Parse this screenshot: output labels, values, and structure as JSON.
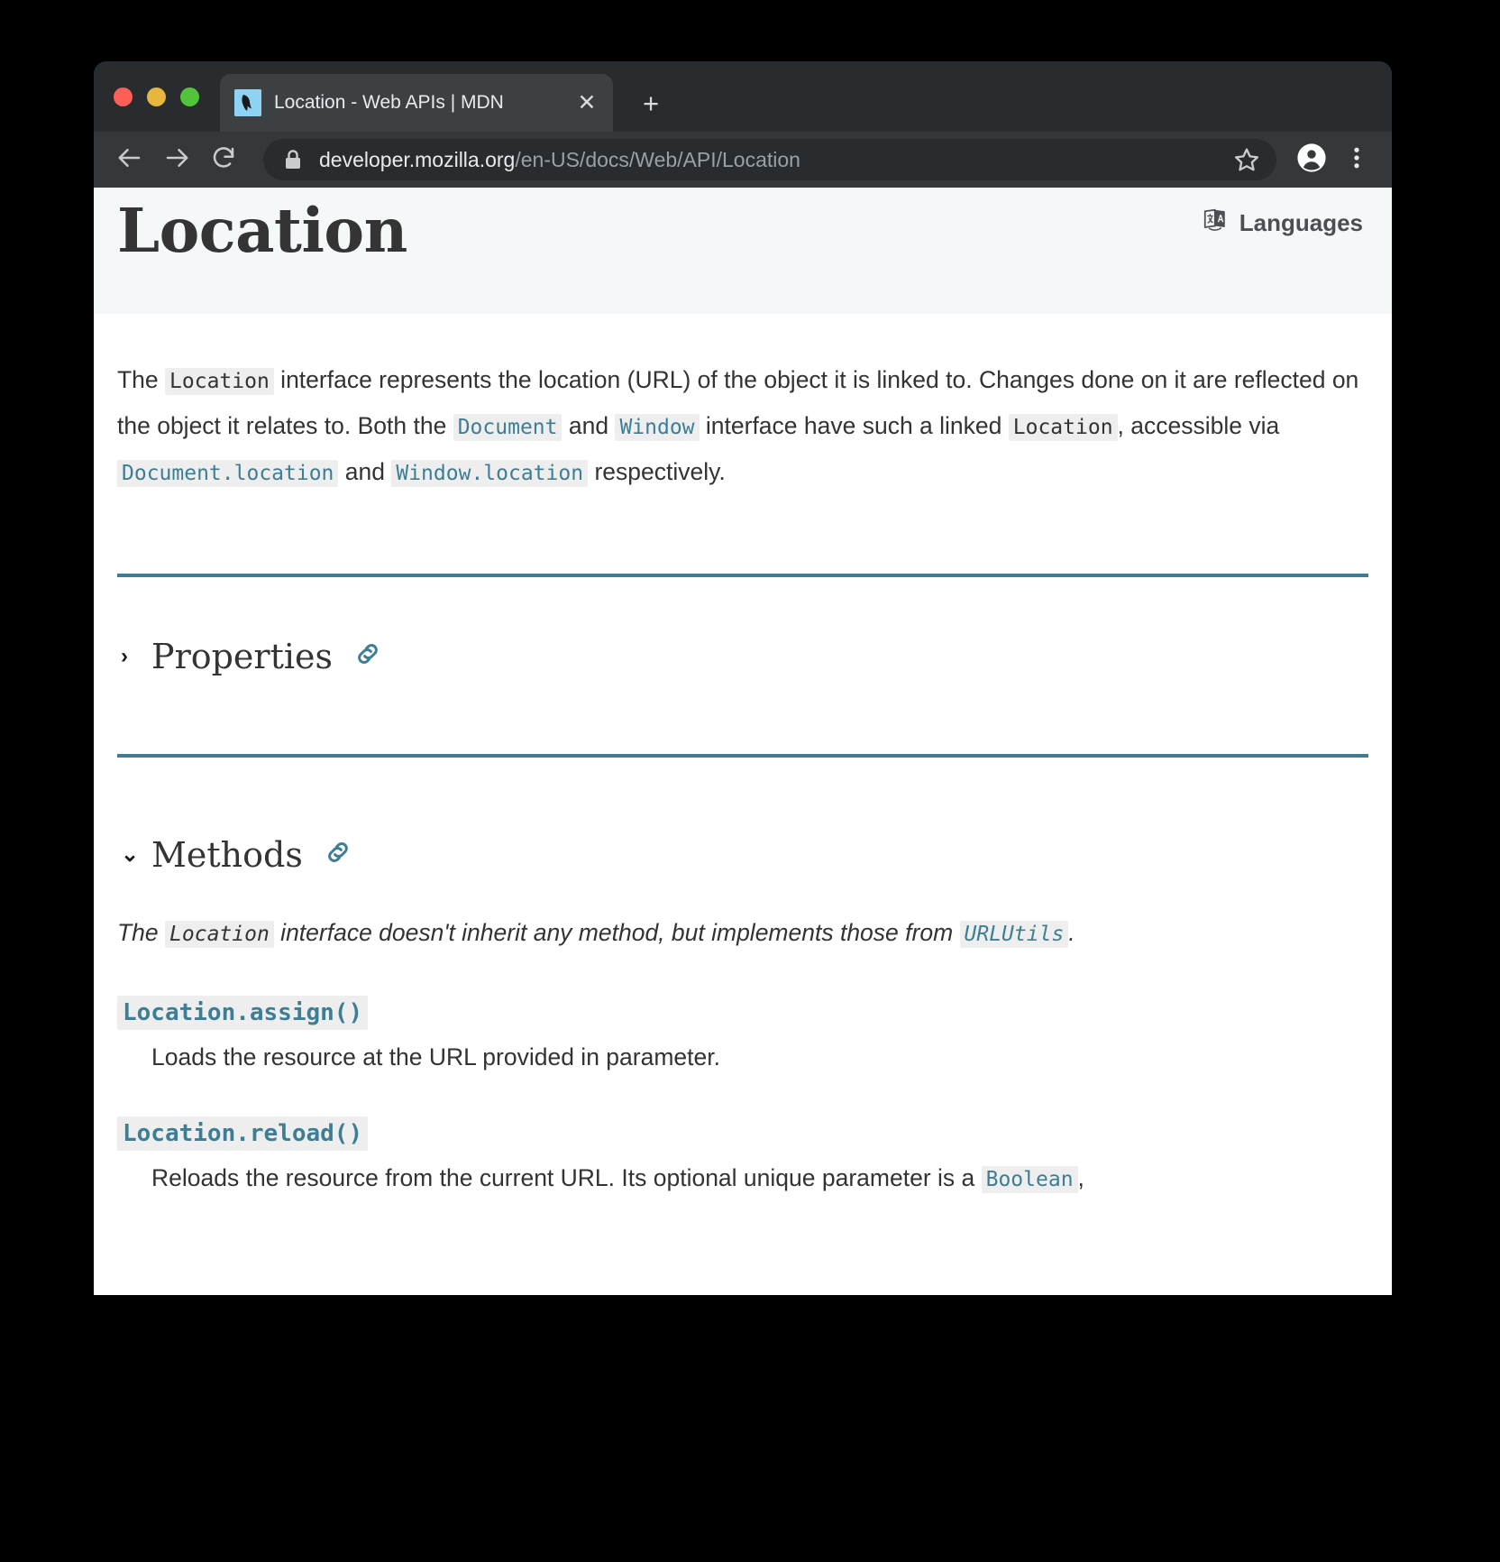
{
  "browser": {
    "traffic_lights": [
      "close",
      "minimize",
      "maximize"
    ],
    "tab": {
      "title": "Location - Web APIs | MDN",
      "favicon_name": "mdn-favicon",
      "close_label": "✕"
    },
    "new_tab_label": "+",
    "toolbar": {
      "back_label": "back-arrow",
      "forward_label": "forward-arrow",
      "reload_label": "reload-arrow",
      "lock_label": "lock-icon",
      "url_host": "developer.mozilla.org",
      "url_path": "/en-US/docs/Web/API/Location",
      "url_full": "developer.mozilla.org/en-US/docs/Web/API/Location",
      "bookmark_label": "star-icon",
      "profile_label": "profile-avatar",
      "menu_label": "three-dot-menu"
    }
  },
  "page": {
    "title": "Location",
    "languages_button": "Languages",
    "intro": {
      "seg1": "The ",
      "code1": "Location",
      "seg2": " interface represents the location (URL) of the object it is linked to. Changes done on it are reflected on the object it relates to. Both the ",
      "code2": "Document",
      "seg3": " and ",
      "code3": "Window",
      "seg4": " interface have such a linked ",
      "code4": "Location",
      "seg5": ", accessible via ",
      "code5": "Document.location",
      "seg6": " and ",
      "code6": "Window.location",
      "seg7": " respectively."
    },
    "sections": [
      {
        "name": "properties",
        "title": "Properties",
        "chevron": "›",
        "expanded": false,
        "anchor_icon": "link-icon"
      },
      {
        "name": "methods",
        "title": "Methods",
        "chevron": "⌄",
        "expanded": true,
        "anchor_icon": "link-icon"
      }
    ],
    "methods_note": {
      "seg1": "The ",
      "code1": "Location",
      "seg2": " interface doesn't inherit any method, but implements those from ",
      "code2": "URLUtils",
      "seg3": "."
    },
    "methods": [
      {
        "signature": "Location.assign()",
        "description": "Loads the resource at the URL provided in parameter."
      },
      {
        "signature": "Location.reload()",
        "desc_seg1": "Reloads the resource from the current URL. Its optional unique parameter is a ",
        "desc_code": "Boolean",
        "desc_seg2": ","
      }
    ]
  },
  "colors": {
    "accent_teal": "#3d7e94",
    "header_bg": "#f5f8f9",
    "chrome_dark": "#292c2f",
    "toolbar_dark": "#35383b",
    "tab_active": "#3c4043",
    "text_body": "#333333",
    "url_dim": "#9aa0a6"
  }
}
